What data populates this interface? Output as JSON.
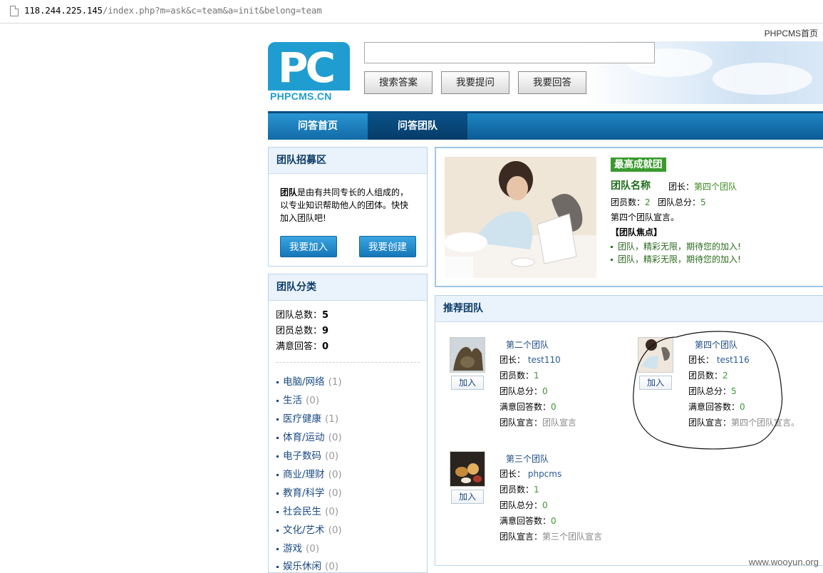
{
  "browser": {
    "url_host": "118.244.225.145",
    "url_path": "/index.php?m=ask&c=team&a=init&belong=team"
  },
  "header": {
    "phpcms_home": "PHPCMS首页",
    "logo_text": "PC",
    "logo_sub": "PHPCMS.CN",
    "search_value": "",
    "buttons": {
      "search": "搜索答案",
      "ask": "我要提问",
      "answer": "我要回答"
    }
  },
  "nav": {
    "home": "问答首页",
    "team": "问答团队"
  },
  "recruit": {
    "title": "团队招募区",
    "intro_bold": "团队",
    "intro_rest": "是由有共同专长的人组成的，以专业知识帮助他人的团体。快快加入团队吧!",
    "join": "我要加入",
    "create": "我要创建"
  },
  "categories": {
    "title": "团队分类",
    "stats": [
      {
        "label": "团队总数：",
        "value": "5"
      },
      {
        "label": "团员总数：",
        "value": "9"
      },
      {
        "label": "满意回答：",
        "value": "0"
      }
    ],
    "items": [
      {
        "name": "电脑/网络",
        "count": "(1)"
      },
      {
        "name": "生活",
        "count": "(0)"
      },
      {
        "name": "医疗健康",
        "count": "(1)"
      },
      {
        "name": "体育/运动",
        "count": "(0)"
      },
      {
        "name": "电子数码",
        "count": "(0)"
      },
      {
        "name": "商业/理财",
        "count": "(0)"
      },
      {
        "name": "教育/科学",
        "count": "(0)"
      },
      {
        "name": "社会民生",
        "count": "(0)"
      },
      {
        "name": "文化/艺术",
        "count": "(0)"
      },
      {
        "name": "游戏",
        "count": "(0)"
      },
      {
        "name": "娱乐休闲",
        "count": "(0)"
      }
    ]
  },
  "featured": {
    "badge": "最高成就团",
    "name_label": "团队名称",
    "leader_label": "团长：",
    "leader": "第四个团队",
    "members_label": "团员数：",
    "members": "2",
    "score_label": "团队总分：",
    "score": "5",
    "declaration": "第四个团队宣言。",
    "focus_title": "【团队焦点】",
    "focus_items": [
      "团队，精彩无限，期待您的加入!",
      "团队，精彩无限，期待您的加入!"
    ]
  },
  "recommended": {
    "title": "推荐团队",
    "labels": {
      "leader": "团长：",
      "members": "团员数：",
      "score": "团队总分：",
      "satisfied": "满意回答数：",
      "declaration": "团队宣言：",
      "join": "加入"
    },
    "teams": [
      {
        "name": "第二个团队",
        "leader": "test110",
        "members": "1",
        "score": "0",
        "satisfied": "0",
        "declaration": "团队宣言"
      },
      {
        "name": "第四个团队",
        "leader": "test116",
        "members": "2",
        "score": "5",
        "satisfied": "0",
        "declaration": "第四个团队宣言。"
      },
      {
        "name": "第三个团队",
        "leader": "phpcms",
        "members": "1",
        "score": "0",
        "satisfied": "0",
        "declaration": "第三个团队宣言"
      }
    ]
  },
  "watermark": "www.wooyun.org"
}
